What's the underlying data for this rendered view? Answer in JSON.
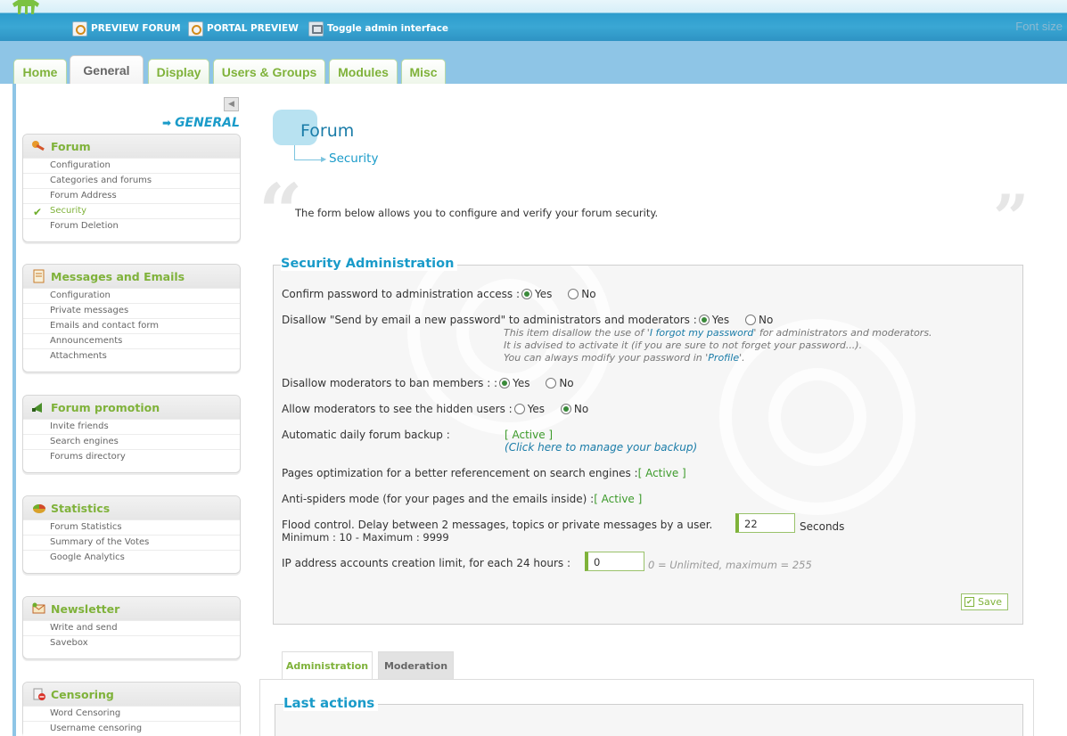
{
  "topbar": {
    "preview_forum": "PREVIEW FORUM",
    "portal_preview": "PORTAL PREVIEW",
    "toggle_admin": "Toggle admin interface",
    "font_size": "Font size"
  },
  "tabs": [
    "Home",
    "General",
    "Display",
    "Users & Groups",
    "Modules",
    "Misc"
  ],
  "sidebar": {
    "section_label": "GENERAL",
    "menus": [
      {
        "title": "Forum",
        "items": [
          "Configuration",
          "Categories and forums",
          "Forum Address",
          "Security",
          "Forum Deletion"
        ],
        "active": 3
      },
      {
        "title": "Messages and Emails",
        "items": [
          "Configuration",
          "Private messages",
          "Emails and contact form",
          "Announcements",
          "Attachments"
        ]
      },
      {
        "title": "Forum promotion",
        "items": [
          "Invite friends",
          "Search engines",
          "Forums directory"
        ]
      },
      {
        "title": "Statistics",
        "items": [
          "Forum Statistics",
          "Summary of the Votes",
          "Google Analytics"
        ]
      },
      {
        "title": "Newsletter",
        "items": [
          "Write and send",
          "Savebox"
        ]
      },
      {
        "title": "Censoring",
        "items": [
          "Word Censoring",
          "Username censoring"
        ]
      }
    ]
  },
  "main": {
    "title": "Forum",
    "subtitle": "Security",
    "intro": "The form below allows you to configure and verify your forum security.",
    "section_title": "Security Administration",
    "yes": "Yes",
    "no": "No",
    "confirm_password": "Confirm password to administration access :",
    "disallow_send": "Disallow \"Send by email a new password\" to administrators and moderators :",
    "hint1_pre": "This item disallow the use of '",
    "hint1_link": "I forgot my password",
    "hint1_post": "' for administrators and moderators.",
    "hint2": "It is advised to activate it (if you are sure to not forget your password...).",
    "hint3_pre": "You can always modify your password in '",
    "hint3_link": "Profile",
    "hint3_post": "'.",
    "disallow_ban": "Disallow moderators to ban members : :",
    "allow_hidden": "Allow moderators to see the hidden users :",
    "backup_label": "Automatic daily forum backup :",
    "backup_status": "[ Active ]",
    "backup_manage_pre": "(",
    "backup_manage_link": "Click here to manage your backup",
    "backup_manage_post": ")",
    "pages_opt": "Pages optimization for a better referencement on search engines :",
    "pages_status": "[ Active ]",
    "anti_spiders": "Anti-spiders mode (for your pages and the emails inside) :",
    "anti_status": "[ Active ]",
    "flood_label": "Flood control. Delay between 2 messages, topics or private messages by a user.",
    "flood_minmax": "Minimum : 10 - Maximum : 9999",
    "flood_value": "22",
    "flood_unit": "Seconds",
    "ip_label": "IP address accounts creation limit, for each 24 hours :",
    "ip_value": "0",
    "ip_note": "0 = Unlimited, maximum = 255",
    "save": "Save"
  },
  "bottom": {
    "tab_admin": "Administration",
    "tab_mod": "Moderation",
    "last_actions": "Last actions"
  }
}
